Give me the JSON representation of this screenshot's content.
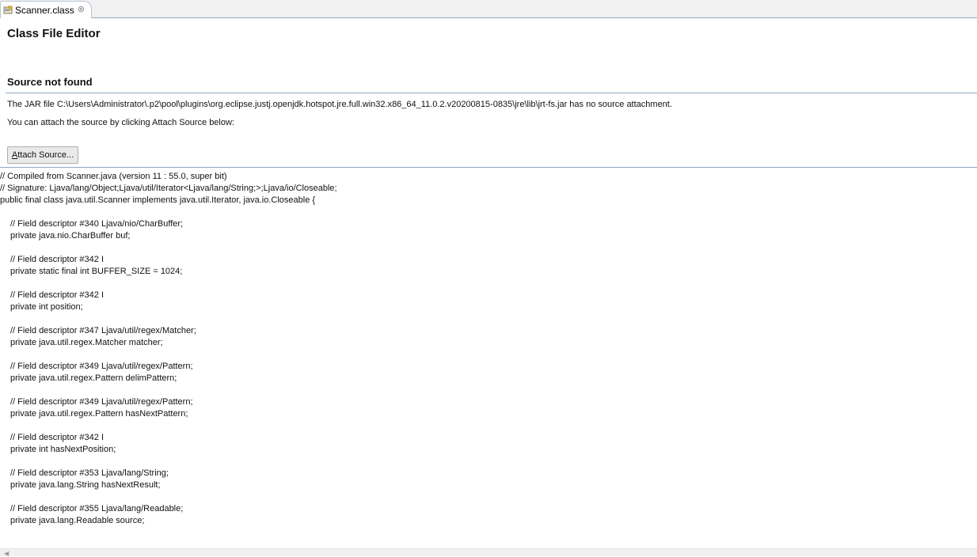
{
  "tab": {
    "label": "Scanner.class",
    "close_symbol": "⊗",
    "icon": "class-file-icon"
  },
  "editor": {
    "title": "Class File Editor",
    "section_title": "Source not found",
    "message_line1": "The JAR file C:\\Users\\Administrator\\.p2\\pool\\plugins\\org.eclipse.justj.openjdk.hotspot.jre.full.win32.x86_64_11.0.2.v20200815-0835\\jre\\lib\\jrt-fs.jar has no source attachment.",
    "message_line2": "You can attach the source by clicking Attach Source below:",
    "attach_button": {
      "mnemonic": "A",
      "rest": "ttach Source..."
    }
  },
  "code_lines": [
    {
      "text": "// Compiled from Scanner.java (version 11 : 55.0, super bit)",
      "indent": false
    },
    {
      "text": "// Signature: Ljava/lang/Object;Ljava/util/Iterator<Ljava/lang/String;>;Ljava/io/Closeable;",
      "indent": false
    },
    {
      "text": "public final class java.util.Scanner implements java.util.Iterator, java.io.Closeable {",
      "indent": false
    },
    {
      "text": "",
      "indent": false
    },
    {
      "text": "// Field descriptor #340 Ljava/nio/CharBuffer;",
      "indent": true
    },
    {
      "text": "private java.nio.CharBuffer buf;",
      "indent": true
    },
    {
      "text": "",
      "indent": false
    },
    {
      "text": "// Field descriptor #342 I",
      "indent": true
    },
    {
      "text": "private static final int BUFFER_SIZE = 1024;",
      "indent": true
    },
    {
      "text": "",
      "indent": false
    },
    {
      "text": "// Field descriptor #342 I",
      "indent": true
    },
    {
      "text": "private int position;",
      "indent": true
    },
    {
      "text": "",
      "indent": false
    },
    {
      "text": "// Field descriptor #347 Ljava/util/regex/Matcher;",
      "indent": true
    },
    {
      "text": "private java.util.regex.Matcher matcher;",
      "indent": true
    },
    {
      "text": "",
      "indent": false
    },
    {
      "text": "// Field descriptor #349 Ljava/util/regex/Pattern;",
      "indent": true
    },
    {
      "text": "private java.util.regex.Pattern delimPattern;",
      "indent": true
    },
    {
      "text": "",
      "indent": false
    },
    {
      "text": "// Field descriptor #349 Ljava/util/regex/Pattern;",
      "indent": true
    },
    {
      "text": "private java.util.regex.Pattern hasNextPattern;",
      "indent": true
    },
    {
      "text": "",
      "indent": false
    },
    {
      "text": "// Field descriptor #342 I",
      "indent": true
    },
    {
      "text": "private int hasNextPosition;",
      "indent": true
    },
    {
      "text": "",
      "indent": false
    },
    {
      "text": "// Field descriptor #353 Ljava/lang/String;",
      "indent": true
    },
    {
      "text": "private java.lang.String hasNextResult;",
      "indent": true
    },
    {
      "text": "",
      "indent": false
    },
    {
      "text": "// Field descriptor #355 Ljava/lang/Readable;",
      "indent": true
    },
    {
      "text": "private java.lang.Readable source;",
      "indent": true
    }
  ],
  "colors": {
    "rule": "#8fa7c4",
    "tab_bg": "#f2f2f2",
    "button_bg": "#e9e9e9"
  }
}
